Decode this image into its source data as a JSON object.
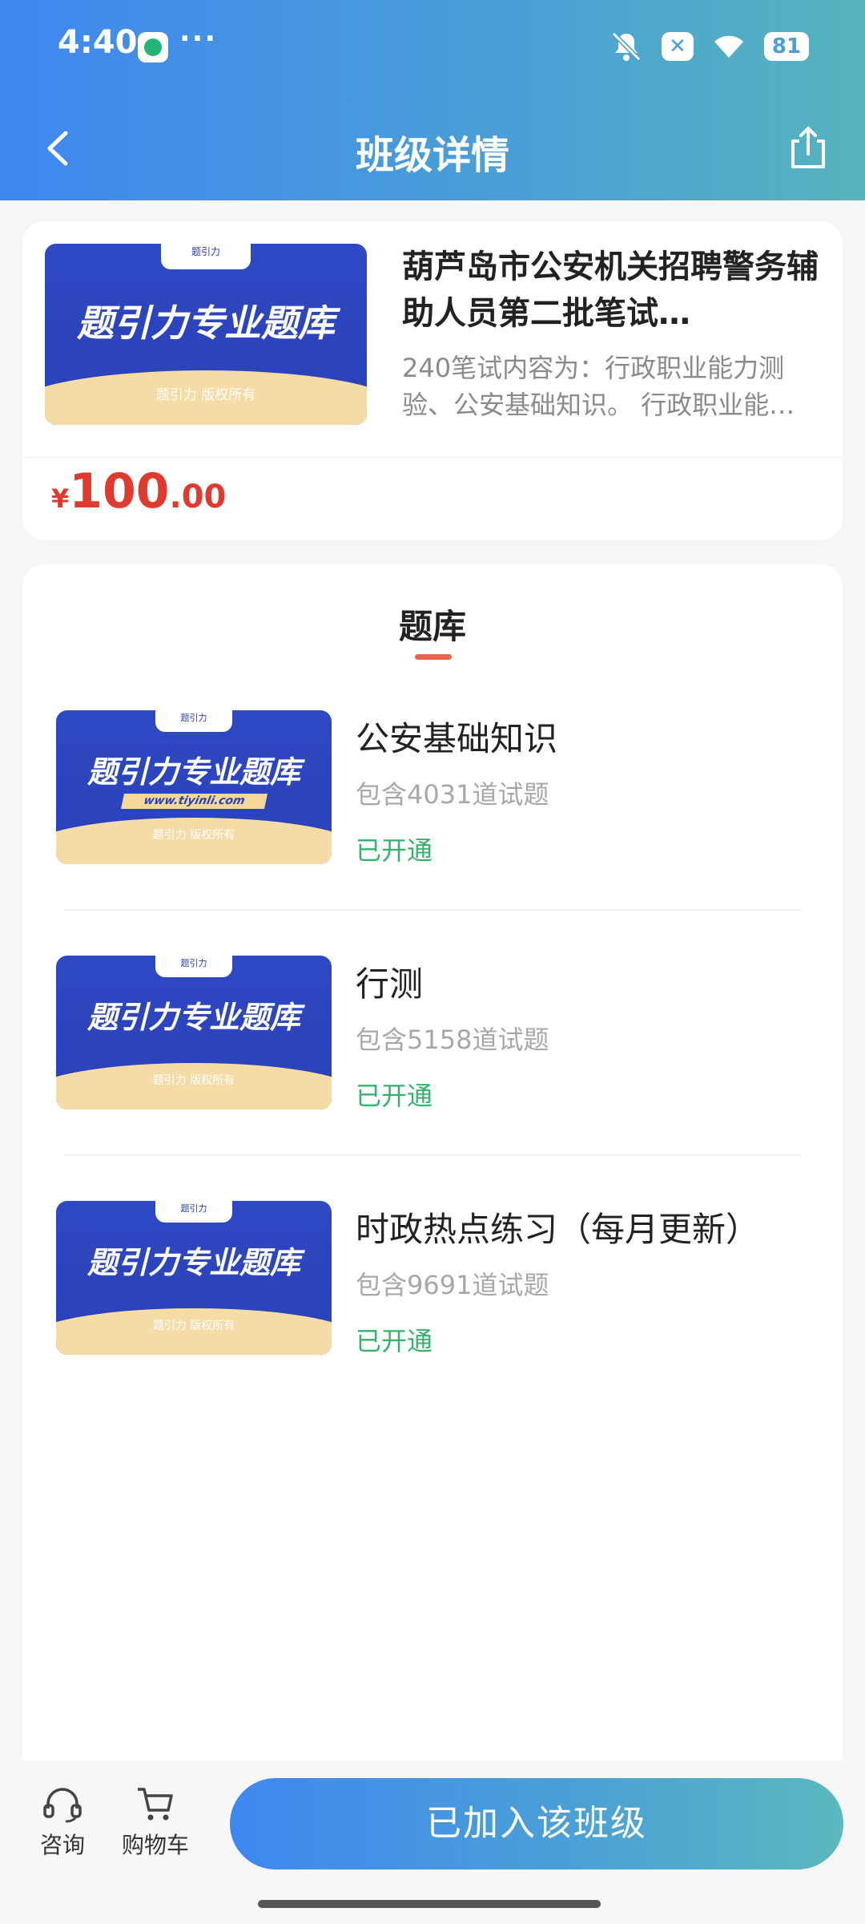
{
  "status_bar": {
    "time": "4:40",
    "more": "···",
    "battery": "81"
  },
  "nav": {
    "title": "班级详情"
  },
  "course": {
    "cover": {
      "tag": "题引力",
      "headline": "题引力专业题库",
      "copyright": "题引力 版权所有"
    },
    "title": "葫芦岛市公安机关招聘警务辅助人员第二批笔试…",
    "description": "240笔试内容为：行政职业能力测验、公安基础知识。 行政职业能…",
    "price": {
      "symbol": "¥",
      "integer": "100",
      "decimal": ".00"
    }
  },
  "bank": {
    "heading": "题库",
    "items": [
      {
        "name": "公安基础知识",
        "count": "包含4031道试题",
        "status": "已开通",
        "cover": {
          "tag": "题引力",
          "headline": "题引力专业题库",
          "url": "www.tiyinli.com",
          "copyright": "题引力 版权所有"
        }
      },
      {
        "name": "行测",
        "count": "包含5158道试题",
        "status": "已开通",
        "cover": {
          "tag": "题引力",
          "headline": "题引力专业题库",
          "copyright": "题引力 版权所有"
        }
      },
      {
        "name": "时政热点练习（每月更新）",
        "count": "包含9691道试题",
        "status": "已开通",
        "cover": {
          "tag": "题引力",
          "headline": "题引力专业题库",
          "copyright": "题引力 版权所有"
        }
      }
    ]
  },
  "bottom_bar": {
    "consult": "咨询",
    "cart": "购物车",
    "join": "已加入该班级"
  },
  "colors": {
    "accent_start": "#3f87f0",
    "accent_end": "#55b4bd",
    "price": "#e03a2f",
    "status_open": "#35b36b",
    "tab_underline": "#e8674a"
  }
}
